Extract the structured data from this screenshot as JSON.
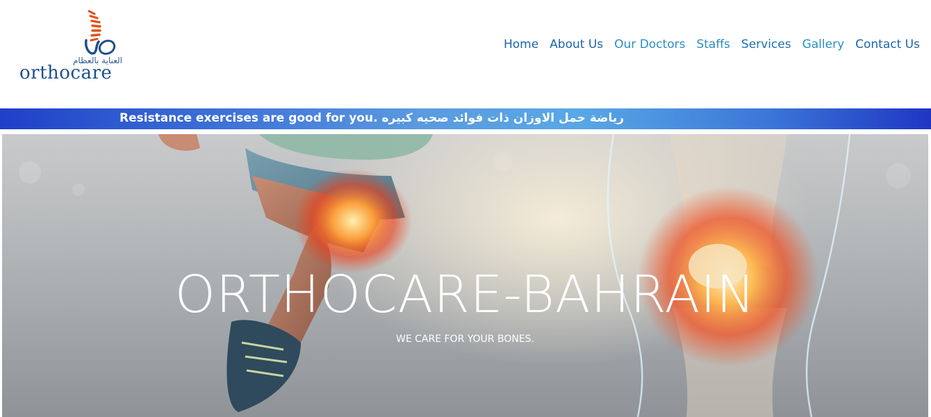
{
  "brand": {
    "arabic_tagline": "العناية بالعظام",
    "name": "orthocare",
    "colors": {
      "primary": "#1d4f8c",
      "accent": "#e05a1e"
    }
  },
  "nav": {
    "items": [
      {
        "label": "Home"
      },
      {
        "label": "About Us"
      },
      {
        "label": "Our Doctors"
      },
      {
        "label": "Staffs"
      },
      {
        "label": "Services"
      },
      {
        "label": "Gallery"
      },
      {
        "label": "Contact Us"
      }
    ]
  },
  "ticker": {
    "text": "Resistance exercises are good for you. رياضة حمل الاوزان ذات فوائد صحيه كبيره"
  },
  "hero": {
    "title": "ORTHOCARE-BAHRAIN",
    "subtitle": "WE CARE FOR YOUR BONES."
  }
}
